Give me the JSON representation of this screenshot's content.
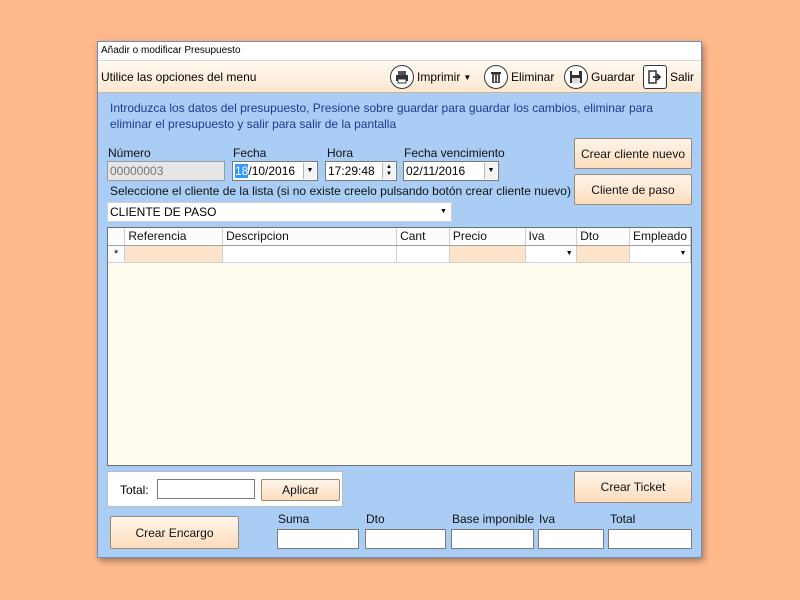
{
  "window": {
    "title": "Añadir o modificar Presupuesto"
  },
  "menubar": {
    "label": "Utilice las opciones del menu",
    "print": "Imprimir",
    "delete": "Eliminar",
    "save": "Guardar",
    "exit": "Salir"
  },
  "instructions": "Introduzca los datos del presupuesto, Presione sobre guardar para guardar los cambios, eliminar para eliminar el presupuesto y salir para salir de la pantalla",
  "form": {
    "numero_label": "Número",
    "numero_value": "00000003",
    "fecha_label": "Fecha",
    "fecha_day": "18",
    "fecha_rest": "/10/2016",
    "hora_label": "Hora",
    "hora_value": "17:29:48",
    "vencimiento_label": "Fecha vencimiento",
    "vencimiento_value": "02/11/2016",
    "cliente_prompt": "Seleccione el cliente de la lista (si no existe creelo pulsando botón crear cliente nuevo)",
    "cliente_value": "CLIENTE DE PASO"
  },
  "buttons": {
    "crear_cliente": "Crear cliente nuevo",
    "cliente_paso": "Cliente de paso",
    "aplicar": "Aplicar",
    "crear_ticket": "Crear Ticket",
    "crear_encargo": "Crear Encargo"
  },
  "grid": {
    "columns": [
      "Referencia",
      "Descripcion",
      "Cant",
      "Precio",
      "Iva",
      "Dto",
      "Empleado"
    ],
    "new_row_marker": "*"
  },
  "total": {
    "label": "Total:"
  },
  "summary": {
    "suma": "Suma",
    "dto": "Dto",
    "base": "Base imponible",
    "iva": "Iva",
    "total": "Total"
  },
  "colors": {
    "background": "#fdb98c",
    "window": "#a9cdf4",
    "accent_text": "#1b3c8c"
  }
}
